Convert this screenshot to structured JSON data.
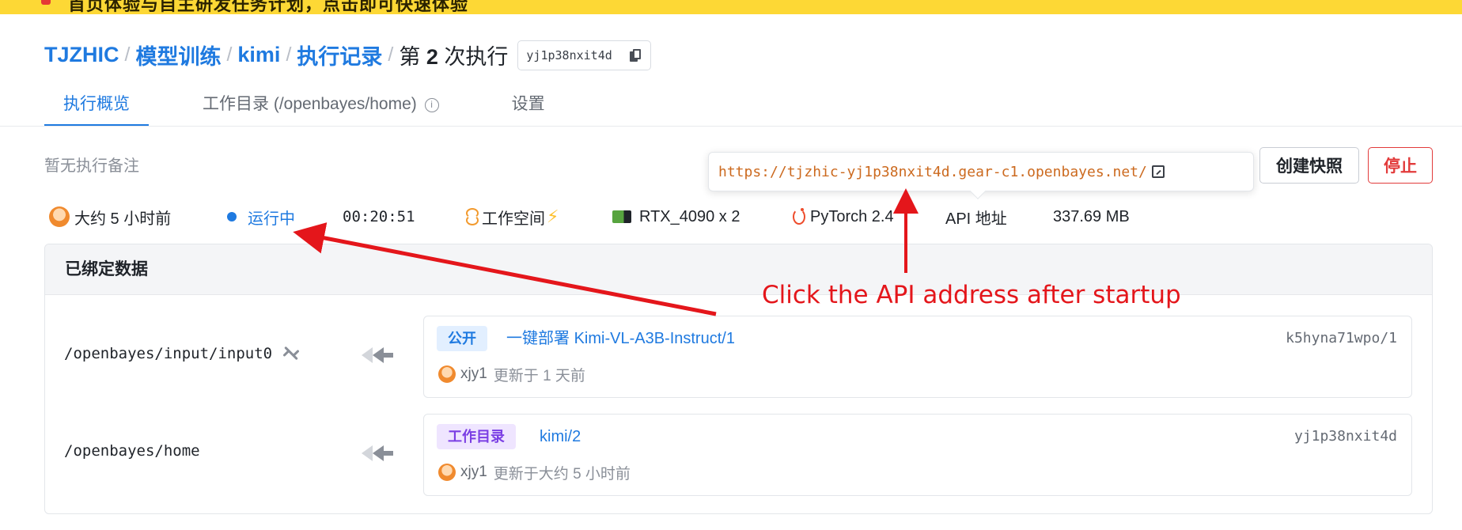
{
  "notice": {
    "text": "首页体验与自主研发任务计划，点击即可快速体验"
  },
  "breadcrumb": {
    "org": "TJZHIC",
    "project": "模型训练",
    "repo": "kimi",
    "section": "执行记录",
    "current_prefix": "第",
    "current_number": "2",
    "current_suffix": "次执行",
    "run_id": "yj1p38nxit4d"
  },
  "tabs": [
    {
      "label": "执行概览",
      "active": true
    },
    {
      "label": "工作目录 (/openbayes/home)",
      "active": false
    },
    {
      "label": "设置",
      "active": false
    }
  ],
  "run": {
    "note": "暂无执行备注",
    "started": "大约 5 小时前",
    "status": "运行中",
    "duration": "00:20:51",
    "workspace": "工作空间",
    "gpu": "RTX_4090 x 2",
    "framework": "PyTorch 2.4",
    "api_label": "API 地址",
    "size": "337.69 MB"
  },
  "tooltip": {
    "url": "https://tjzhic-yj1p38nxit4d.gear-c1.openbayes.net/"
  },
  "actions": {
    "snapshot": "创建快照",
    "stop": "停止"
  },
  "bindings": {
    "title": "已绑定数据",
    "items": [
      {
        "path": "/openbayes/input/input0",
        "tag": "公开",
        "source_prefix": "一键部署",
        "source_name": "Kimi-VL-A3B-Instruct/1",
        "source_id": "k5hyna71wpo/1",
        "user": "xjy1",
        "updated": "更新于 1 天前"
      },
      {
        "path": "/openbayes/home",
        "tag": "工作目录",
        "source_prefix": "",
        "source_name": "kimi/2",
        "source_id": "yj1p38nxit4d",
        "user": "xjy1",
        "updated": "更新于大约 5 小时前"
      }
    ]
  },
  "annotation": {
    "text": "Click the API address after startup",
    "color": "#e4161b"
  },
  "colors": {
    "accent": "#1f7ae0",
    "notice": "#fdd835",
    "danger": "#e23b3b"
  },
  "icons": [
    "copy-icon",
    "info-icon",
    "external-link-icon",
    "status-dot-icon",
    "workspace-icon",
    "bolt-icon",
    "nvidia-gpu-icon",
    "pytorch-icon",
    "unlink-icon",
    "left-arrow-icon",
    "avatar"
  ]
}
